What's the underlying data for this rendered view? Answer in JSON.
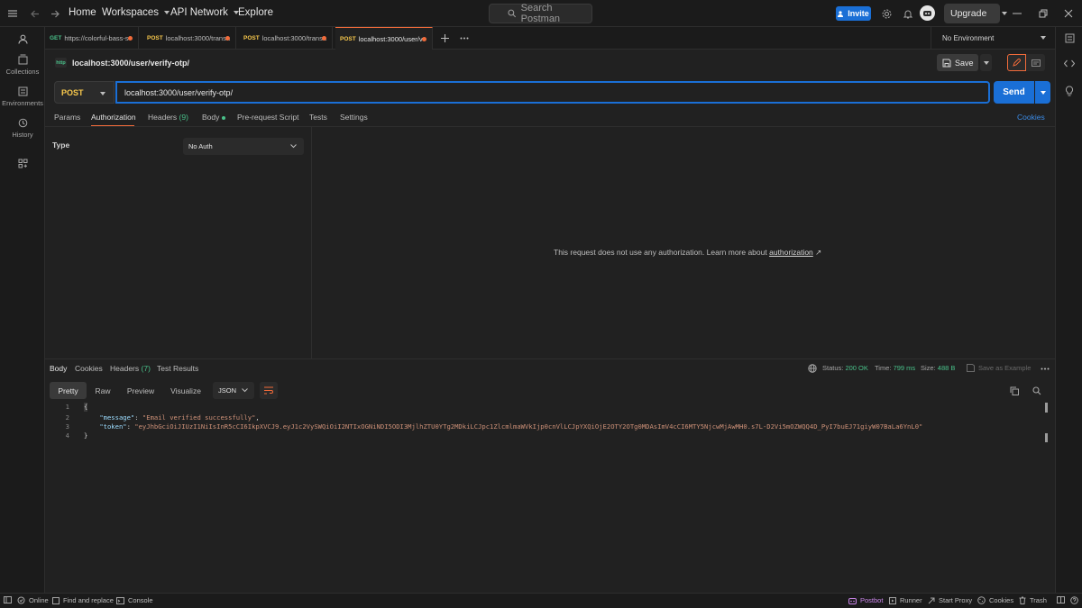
{
  "topbar": {
    "nav": {
      "home": "Home",
      "workspaces": "Workspaces",
      "api_network": "API Network",
      "explore": "Explore"
    },
    "search_placeholder": "Search Postman",
    "invite_label": "Invite",
    "upgrade_label": "Upgrade"
  },
  "sidebar": {
    "items": [
      {
        "label": "Collections"
      },
      {
        "label": "Environments"
      },
      {
        "label": "History"
      }
    ]
  },
  "tabs": [
    {
      "method": "GET",
      "title": "https://colorful-bass-s",
      "method_color": "#49c18a"
    },
    {
      "method": "POST",
      "title": "localhost:3000/transa",
      "method_color": "#f9c94c"
    },
    {
      "method": "POST",
      "title": "localhost:3000/transa",
      "method_color": "#f9c94c"
    },
    {
      "method": "POST",
      "title": "localhost:3000/user/v",
      "method_color": "#f9c94c"
    }
  ],
  "environment": {
    "selected": "No Environment"
  },
  "request": {
    "title": "localhost:3000/user/verify-otp/",
    "save_label": "Save",
    "method": "POST",
    "url": "localhost:3000/user/verify-otp/",
    "send_label": "Send",
    "tabs": {
      "params": "Params",
      "authorization": "Authorization",
      "headers": "Headers",
      "headers_count": "(9)",
      "body": "Body",
      "pre_request": "Pre-request Script",
      "tests": "Tests",
      "settings": "Settings"
    },
    "cookies_label": "Cookies",
    "auth": {
      "type_label": "Type",
      "type_value": "No Auth",
      "message": "This request does not use any authorization. Learn more about",
      "link": "authorization",
      "link_arrow": "↗"
    }
  },
  "response": {
    "tabs": {
      "body": "Body",
      "cookies": "Cookies",
      "headers": "Headers",
      "headers_count": "(7)",
      "test_results": "Test Results"
    },
    "status_label": "Status:",
    "status_value": "200 OK",
    "time_label": "Time:",
    "time_value": "799 ms",
    "size_label": "Size:",
    "size_value": "488 B",
    "save_example": "Save as Example",
    "formats": {
      "pretty": "Pretty",
      "raw": "Raw",
      "preview": "Preview",
      "visualize": "Visualize"
    },
    "format_type": "JSON",
    "lines": [
      {
        "n": "1",
        "text": "{"
      },
      {
        "n": "2",
        "key": "\"message\"",
        "value": "\"Email verified successfully\"",
        "end": ","
      },
      {
        "n": "3",
        "key": "\"token\"",
        "value": "\"eyJhbGciOiJIUzI1NiIsInR5cCI6IkpXVCJ9.eyJ1c2VySWQiOiI2NTIxOGNiNDI5ODI3MjlhZTU0YTg2MDkiLCJpc1ZlcmlmaWVkIjp0cnVlLCJpYXQiOjE2OTY2OTg0MDAsImV4cCI6MTY5NjcwMjAwMH0.s7L-D2Vi5mOZWQQ4D_PyI7buEJ71giyW07BaLa6YnL0\"",
        "end": ""
      },
      {
        "n": "4",
        "text": "}"
      }
    ]
  },
  "footer": {
    "online": "Online",
    "find_replace": "Find and replace",
    "console": "Console",
    "postbot": "Postbot",
    "runner": "Runner",
    "start_proxy": "Start Proxy",
    "cookies": "Cookies",
    "trash": "Trash"
  }
}
